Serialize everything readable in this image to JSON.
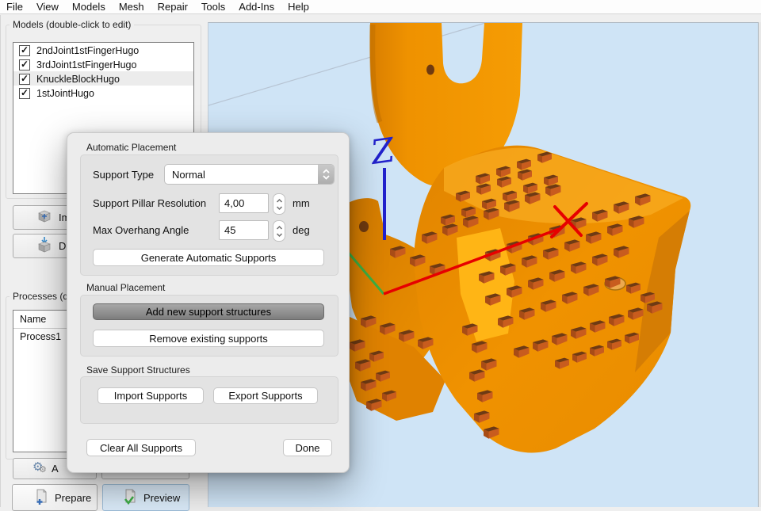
{
  "menu": {
    "items": [
      "File",
      "View",
      "Models",
      "Mesh",
      "Repair",
      "Tools",
      "Add-Ins",
      "Help"
    ]
  },
  "models_panel": {
    "title": "Models (double-click to edit)",
    "items": [
      {
        "label": "2ndJoint1stFingerHugo",
        "checked": true
      },
      {
        "label": "3rdJoint1stFingerHugo",
        "checked": true
      },
      {
        "label": "KnuckleBlockHugo",
        "checked": true
      },
      {
        "label": "1stJointHugo",
        "checked": true
      }
    ],
    "import_button_label": "Imp",
    "drop_button_label": "Dr"
  },
  "processes_panel": {
    "title": "Processes (dou",
    "columns": [
      "Name"
    ],
    "rows": [
      "Process1"
    ],
    "add_button_label": "A"
  },
  "bottom_bar": {
    "prepare_label": "Prepare",
    "preview_label": "Preview"
  },
  "support_dialog": {
    "sections": {
      "automatic": "Automatic Placement",
      "manual": "Manual Placement",
      "save": "Save Support Structures"
    },
    "support_type": {
      "label": "Support Type",
      "value": "Normal"
    },
    "pillar_resolution": {
      "label": "Support Pillar Resolution",
      "value": "4,00",
      "unit": "mm"
    },
    "max_overhang": {
      "label": "Max Overhang Angle",
      "value": "45",
      "unit": "deg"
    },
    "generate_button": "Generate Automatic Supports",
    "add_button": "Add new support structures",
    "remove_button": "Remove existing supports",
    "import_button": "Import Supports",
    "export_button": "Export Supports",
    "clear_button": "Clear All Supports",
    "done_button": "Done"
  },
  "viewport": {
    "axis_labels": {
      "z": "Z",
      "x": "X"
    },
    "colors": {
      "background": "#cfe4f6",
      "model_orange": "#f09200",
      "model_dark": "#d27a00",
      "model_light": "#ffb515",
      "support_front": "#c85c1e",
      "support_top": "#6e3a14",
      "support_side": "#a84c16",
      "axis_x": "#e60000",
      "axis_y": "#3cb043",
      "axis_z": "#2222cc",
      "hole": "#6f3a10"
    }
  },
  "icons": {
    "check": "✓",
    "gear": "⚙"
  }
}
